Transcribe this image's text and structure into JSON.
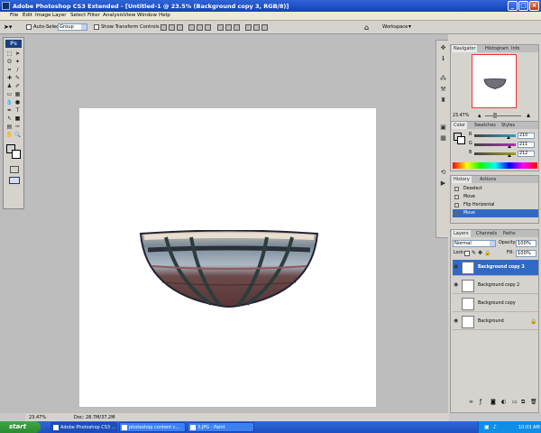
{
  "window": {
    "title": "Adobe Photoshop CS3 Extended - [Untitled-1 @ 23.5% (Background copy 3, RGB/8)]",
    "logo": "PS"
  },
  "menu": [
    "File",
    "Edit",
    "Image",
    "Layer",
    "Select",
    "Filter",
    "Analysis",
    "View",
    "Window",
    "Help"
  ],
  "options": {
    "auto_select_label": "Auto-Select:",
    "auto_select_value": "Group",
    "transform_label": "Show Transform Controls",
    "workspace_label": "Workspace"
  },
  "toolbox": {
    "logo": "Ps"
  },
  "status": {
    "zoom": "23.47%",
    "doc": "Doc: 28.7M/37.2M"
  },
  "navigator": {
    "tabs": [
      "Navigator",
      "Histogram",
      "Info"
    ],
    "zoom": "23.47%"
  },
  "color": {
    "tabs": [
      "Color",
      "Swatches",
      "Styles"
    ],
    "channels": [
      {
        "label": "R",
        "value": "210",
        "fill": 0.82,
        "color": "#30a0b8"
      },
      {
        "label": "G",
        "value": "211",
        "fill": 0.83,
        "color": "#b030b0"
      },
      {
        "label": "B",
        "value": "212",
        "fill": 0.83,
        "color": "#a0a020"
      }
    ]
  },
  "history": {
    "tabs": [
      "History",
      "Actions"
    ],
    "items": [
      "Deselect",
      "Move",
      "Flip Horizontal",
      "Move"
    ]
  },
  "layers": {
    "tabs": [
      "Layers",
      "Channels",
      "Paths"
    ],
    "blend_mode": "Normal",
    "opacity_label": "Opacity:",
    "opacity_value": "100%",
    "lock_label": "Lock:",
    "fill_label": "Fill:",
    "fill_value": "100%",
    "items": [
      {
        "name": "Background copy 3",
        "visible": true,
        "selected": true
      },
      {
        "name": "Background copy 2",
        "visible": true,
        "selected": false
      },
      {
        "name": "Background copy",
        "visible": false,
        "selected": false
      },
      {
        "name": "Background",
        "visible": true,
        "selected": false,
        "locked": true
      }
    ]
  },
  "taskbar": {
    "start_label": "start",
    "buttons": [
      {
        "label": "Adobe Photoshop CS3 ...",
        "active": true
      },
      {
        "label": "photoshop content c...",
        "active": false
      },
      {
        "label": "3.JPG - Paint",
        "active": false
      }
    ],
    "clock": "10:03 AM"
  },
  "colors": {
    "accent": "#316ac5",
    "titlebar": "#1f54cc",
    "start": "#35a03c"
  }
}
